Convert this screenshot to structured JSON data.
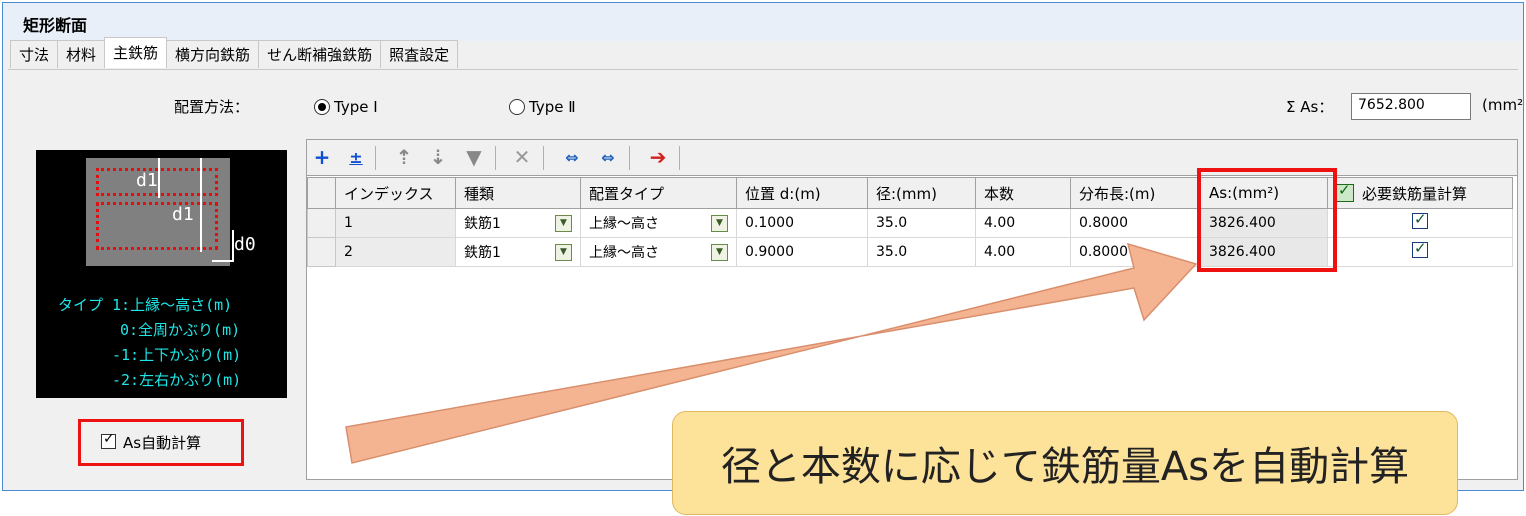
{
  "window": {
    "title": "矩形断面"
  },
  "tabs": [
    "寸法",
    "材料",
    "主鉄筋",
    "横方向鉄筋",
    "せん断補強鉄筋",
    "照査設定"
  ],
  "placement": {
    "label": "配置方法：",
    "option1": "Type Ⅰ",
    "option2": "Type Ⅱ",
    "selected": "Type Ⅰ"
  },
  "sum": {
    "label": "Σ As：",
    "value": "7652.800",
    "unit": "(mm²"
  },
  "diagram": {
    "d1_top": "d1",
    "d1_side": "d1",
    "d0": "d0",
    "legend": [
      "タイプ 1:上縁～高さ(m)",
      "0:全周かぶり(m)",
      "-1:上下かぶり(m)",
      "-2:左右かぶり(m)"
    ]
  },
  "autocalc": {
    "label": "As自動計算",
    "checked": true
  },
  "toolbar": {
    "icons": [
      "add-icon",
      "insert-icon",
      "move-up-icon",
      "move-down-icon",
      "copy-down-icon",
      "delete-icon",
      "expand-icon",
      "renumber-icon",
      "export-icon"
    ]
  },
  "grid": {
    "headers": [
      "インデックス",
      "種類",
      "配置タイプ",
      "位置 d:(m)",
      "径:(mm)",
      "本数",
      "分布長:(m)",
      "As:(mm²)",
      "必要鉄筋量計算"
    ],
    "rows": [
      {
        "index": "1",
        "type": "鉄筋1",
        "placement": "上縁～高さ",
        "position": "0.1000",
        "diameter": "35.0",
        "count": "4.00",
        "length": "0.8000",
        "as": "3826.400",
        "required": true
      },
      {
        "index": "2",
        "type": "鉄筋1",
        "placement": "上縁～高さ",
        "position": "0.9000",
        "diameter": "35.0",
        "count": "4.00",
        "length": "0.8000",
        "as": "3826.400",
        "required": true
      }
    ]
  },
  "callout": {
    "text": "径と本数に応じて鉄筋量Asを自動計算"
  },
  "colors": {
    "highlight_red": "#ee1111",
    "arrow": "#f5b08c",
    "callout_bg": "#fde29a",
    "legend_text": "#1ee6e6"
  }
}
